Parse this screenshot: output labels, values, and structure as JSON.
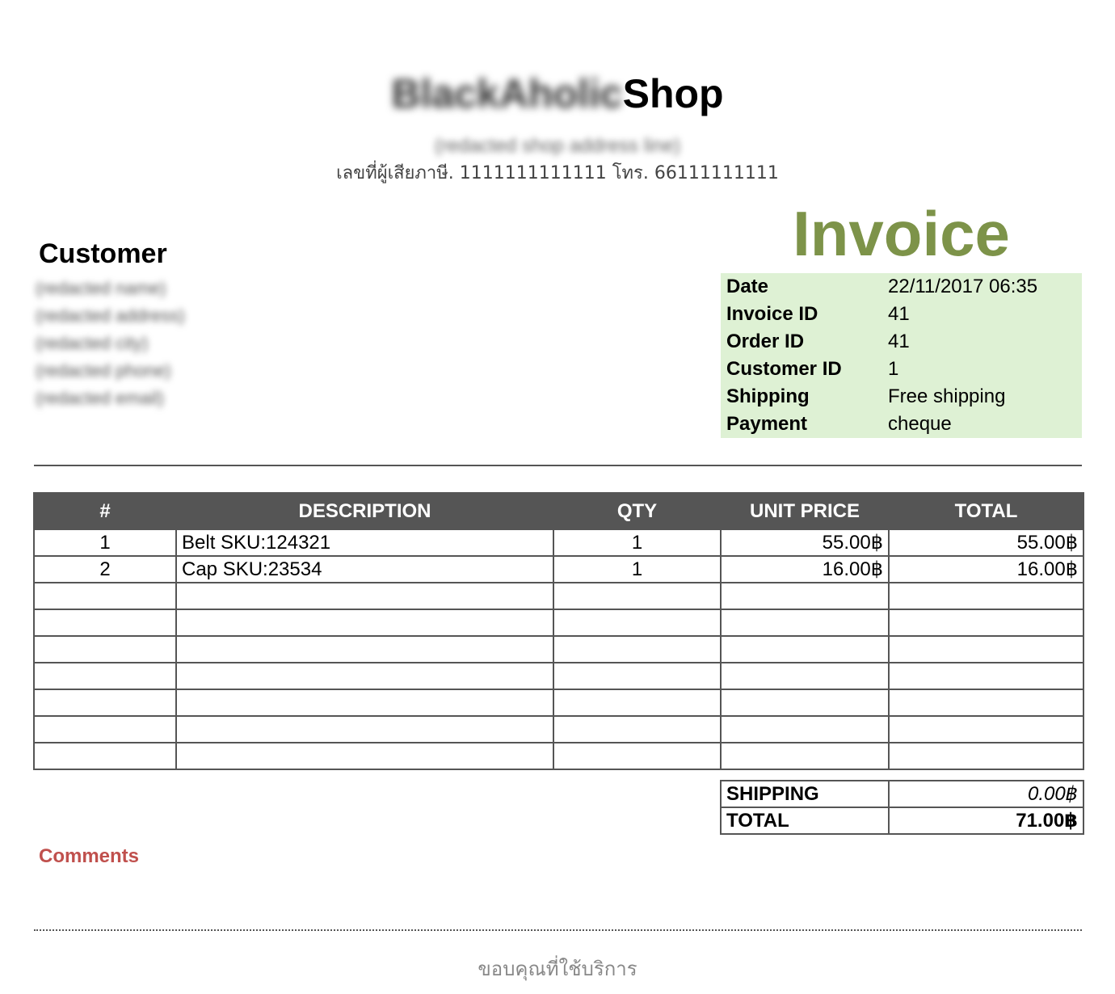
{
  "header": {
    "shop_name_blurred": "BlackAholic",
    "shop_name": "Shop",
    "address": "(redacted shop address line)",
    "tax_line": "เลขที่ผู้เสียภาษี. 1111111111111 โทร. 66111111111"
  },
  "customer": {
    "heading": "Customer",
    "lines": [
      "(redacted name)",
      "(redacted address)",
      "(redacted city)",
      "(redacted phone)",
      "(redacted email)"
    ]
  },
  "invoice": {
    "title": "Invoice",
    "title_color": "#7d9349",
    "meta_background": "#def1d4",
    "meta": [
      {
        "label": "Date",
        "value": "22/11/2017 06:35"
      },
      {
        "label": "Invoice ID",
        "value": "41"
      },
      {
        "label": "Order ID",
        "value": "41"
      },
      {
        "label": "Customer ID",
        "value": "1"
      },
      {
        "label": "Shipping",
        "value": "Free shipping"
      },
      {
        "label": "Payment",
        "value": "cheque"
      }
    ]
  },
  "items_table": {
    "header_background": "#555555",
    "columns": [
      "#",
      "DESCRIPTION",
      "QTY",
      "UNIT PRICE",
      "TOTAL"
    ],
    "rows": [
      {
        "num": "1",
        "description": "Belt SKU:124321",
        "qty": "1",
        "unit_price": "55.00฿",
        "total": "55.00฿"
      },
      {
        "num": "2",
        "description": "Cap SKU:23534",
        "qty": "1",
        "unit_price": "16.00฿",
        "total": "16.00฿"
      },
      {
        "num": "",
        "description": "",
        "qty": "",
        "unit_price": "",
        "total": ""
      },
      {
        "num": "",
        "description": "",
        "qty": "",
        "unit_price": "",
        "total": ""
      },
      {
        "num": "",
        "description": "",
        "qty": "",
        "unit_price": "",
        "total": ""
      },
      {
        "num": "",
        "description": "",
        "qty": "",
        "unit_price": "",
        "total": ""
      },
      {
        "num": "",
        "description": "",
        "qty": "",
        "unit_price": "",
        "total": ""
      },
      {
        "num": "",
        "description": "",
        "qty": "",
        "unit_price": "",
        "total": ""
      },
      {
        "num": "",
        "description": "",
        "qty": "",
        "unit_price": "",
        "total": ""
      }
    ]
  },
  "summary": {
    "shipping_label": "SHIPPING",
    "shipping_value": "0.00฿",
    "total_label": "TOTAL",
    "total_value": "71.00฿"
  },
  "comments": {
    "label": "Comments",
    "color": "#c0504d"
  },
  "footer": {
    "thanks": "ขอบคุณที่ใช้บริการ"
  }
}
